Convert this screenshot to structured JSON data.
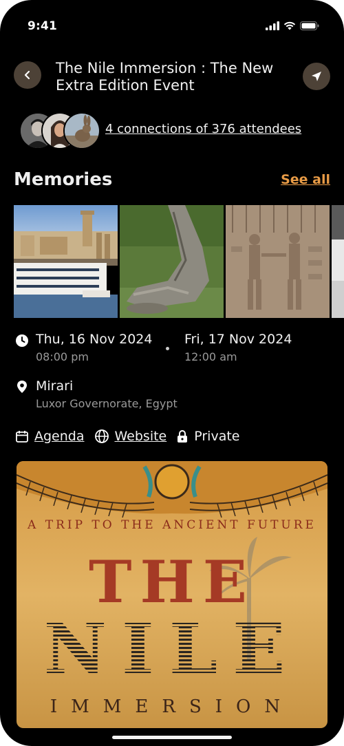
{
  "status_bar": {
    "time": "9:41"
  },
  "header": {
    "title": "The Nile Immersion : The New Extra Edition Event"
  },
  "connections": {
    "text": "4 connections of 376 attendees",
    "avatars": [
      "man-portrait",
      "woman-portrait",
      "rabbit-portrait"
    ]
  },
  "memories": {
    "title": "Memories",
    "see_all": "See all",
    "photos": [
      "nile-cruise-boat-luxor-temple",
      "crocodile-on-grass",
      "egyptian-hieroglyph-relief",
      "partial-photo"
    ]
  },
  "event_dates": {
    "start_date": "Thu, 16 Nov 2024",
    "start_time": "08:00 pm",
    "end_date": "Fri, 17 Nov 2024",
    "end_time": "12:00 am"
  },
  "location": {
    "name": "Mirari",
    "address": "Luxor Governorate, Egypt"
  },
  "links": {
    "agenda": "Agenda",
    "website": "Website",
    "privacy": "Private"
  },
  "poster": {
    "subtitle": "A TRIP TO THE ANCIENT FUTURE",
    "word_the": "THE",
    "word_nile": "NILE",
    "word_immersion": "IMMERSION",
    "colors": {
      "background": "#d9a552",
      "ink": "#8a2a1a",
      "stripes": "#2a2520"
    }
  },
  "colors": {
    "accent": "#e89b46",
    "button_bg": "#4d4237",
    "background": "#000000"
  }
}
